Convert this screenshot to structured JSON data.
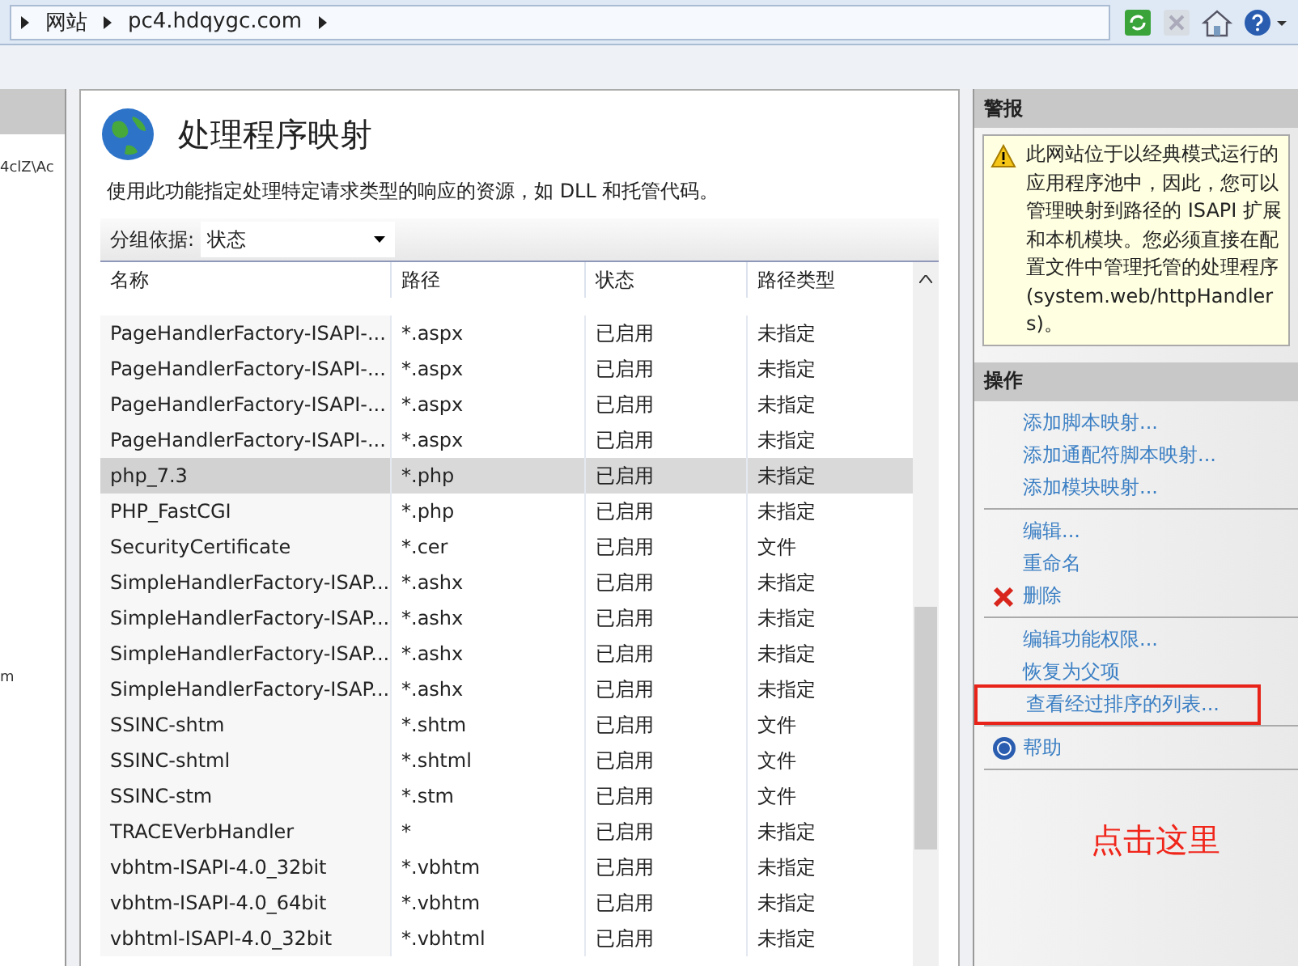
{
  "address_bar": {
    "crumbs": [
      "网站",
      "pc4.hdqygc.com"
    ]
  },
  "left_pane": {
    "texts": [
      "4clZ\\Ac",
      "m"
    ]
  },
  "feature": {
    "title": "处理程序映射",
    "description": "使用此功能指定处理特定请求类型的响应的资源，如 DLL 和托管代码。",
    "group_by": {
      "label": "分组依据:",
      "value": "状态"
    },
    "table": {
      "columns": [
        "名称",
        "路径",
        "状态",
        "路径类型"
      ],
      "rows": [
        {
          "cells": [
            "PageHandlerFactory-ISAPI-...",
            "*.aspx",
            "已启用",
            "未指定"
          ],
          "selected": false
        },
        {
          "cells": [
            "PageHandlerFactory-ISAPI-...",
            "*.aspx",
            "已启用",
            "未指定"
          ],
          "selected": false
        },
        {
          "cells": [
            "PageHandlerFactory-ISAPI-...",
            "*.aspx",
            "已启用",
            "未指定"
          ],
          "selected": false
        },
        {
          "cells": [
            "PageHandlerFactory-ISAPI-...",
            "*.aspx",
            "已启用",
            "未指定"
          ],
          "selected": false
        },
        {
          "cells": [
            "php_7.3",
            "*.php",
            "已启用",
            "未指定"
          ],
          "selected": true
        },
        {
          "cells": [
            "PHP_FastCGI",
            "*.php",
            "已启用",
            "未指定"
          ],
          "selected": false
        },
        {
          "cells": [
            "SecurityCertificate",
            "*.cer",
            "已启用",
            "文件"
          ],
          "selected": false
        },
        {
          "cells": [
            "SimpleHandlerFactory-ISAP...",
            "*.ashx",
            "已启用",
            "未指定"
          ],
          "selected": false
        },
        {
          "cells": [
            "SimpleHandlerFactory-ISAP...",
            "*.ashx",
            "已启用",
            "未指定"
          ],
          "selected": false
        },
        {
          "cells": [
            "SimpleHandlerFactory-ISAP...",
            "*.ashx",
            "已启用",
            "未指定"
          ],
          "selected": false
        },
        {
          "cells": [
            "SimpleHandlerFactory-ISAP...",
            "*.ashx",
            "已启用",
            "未指定"
          ],
          "selected": false
        },
        {
          "cells": [
            "SSINC-shtm",
            "*.shtm",
            "已启用",
            "文件"
          ],
          "selected": false
        },
        {
          "cells": [
            "SSINC-shtml",
            "*.shtml",
            "已启用",
            "文件"
          ],
          "selected": false
        },
        {
          "cells": [
            "SSINC-stm",
            "*.stm",
            "已启用",
            "文件"
          ],
          "selected": false
        },
        {
          "cells": [
            "TRACEVerbHandler",
            "*",
            "已启用",
            "未指定"
          ],
          "selected": false
        },
        {
          "cells": [
            "vbhtm-ISAPI-4.0_32bit",
            "*.vbhtm",
            "已启用",
            "未指定"
          ],
          "selected": false
        },
        {
          "cells": [
            "vbhtm-ISAPI-4.0_64bit",
            "*.vbhtm",
            "已启用",
            "未指定"
          ],
          "selected": false
        },
        {
          "cells": [
            "vbhtml-ISAPI-4.0_32bit",
            "*.vbhtml",
            "已启用",
            "未指定"
          ],
          "selected": false
        }
      ]
    }
  },
  "alerts": {
    "title": "警报",
    "message": "此网站位于以经典模式运行的应用程序池中，因此，您可以管理映射到路径的 ISAPI 扩展和本机模块。您必须直接在配置文件中管理托管的处理程序(system.web/httpHandlers)。"
  },
  "actions": {
    "title": "操作",
    "groups": [
      [
        {
          "label": "添加脚本映射...",
          "kind": "link",
          "highlighted": false
        },
        {
          "label": "添加通配符脚本映射...",
          "kind": "link",
          "highlighted": false
        },
        {
          "label": "添加模块映射...",
          "kind": "link",
          "highlighted": false
        }
      ],
      [
        {
          "label": "编辑...",
          "kind": "link",
          "highlighted": false
        },
        {
          "label": "重命名",
          "kind": "link",
          "highlighted": false
        },
        {
          "label": "删除",
          "kind": "delete",
          "highlighted": false
        }
      ],
      [
        {
          "label": "编辑功能权限...",
          "kind": "link",
          "highlighted": false
        },
        {
          "label": "恢复为父项",
          "kind": "link",
          "highlighted": false
        },
        {
          "label": "查看经过排序的列表...",
          "kind": "link",
          "highlighted": true
        }
      ],
      [
        {
          "label": "帮助",
          "kind": "help",
          "highlighted": false
        }
      ]
    ]
  },
  "annotation": {
    "text": "点击这里"
  }
}
